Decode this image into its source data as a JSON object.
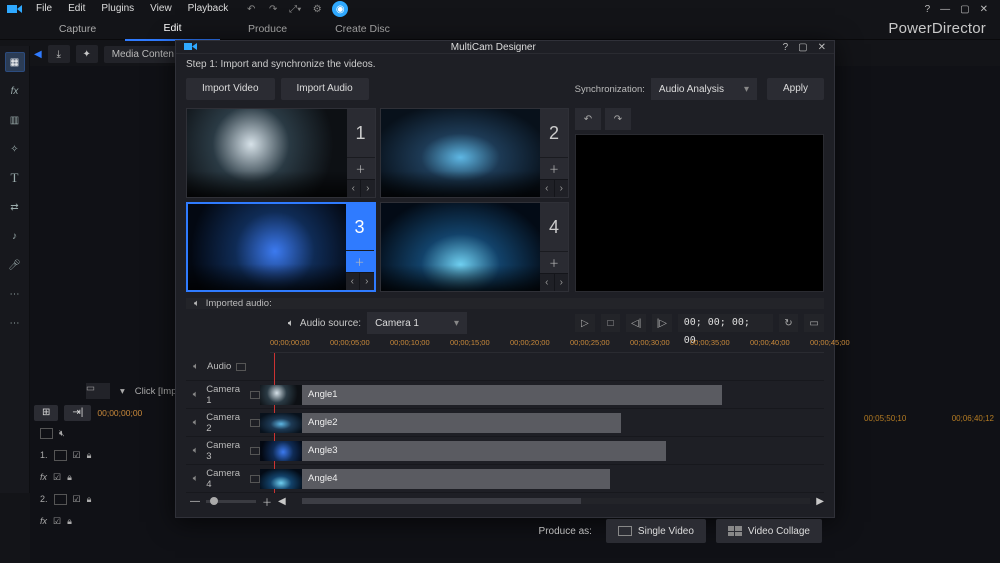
{
  "menubar": {
    "items": [
      "File",
      "Edit",
      "Plugins",
      "View",
      "Playback"
    ]
  },
  "window": {
    "help": "?",
    "min": "—",
    "close": "✕",
    "max": "▢"
  },
  "modes": {
    "items": [
      "Capture",
      "Edit",
      "Produce",
      "Create Disc"
    ],
    "active": 1
  },
  "brand": "PowerDirector",
  "shelf": {
    "media": "Media Conten"
  },
  "import_row": {
    "hint": "Click [Import]"
  },
  "bg_timeline": {
    "timecode": "00;00;00;00",
    "marks": [
      "00;05;50;10",
      "00;06;40;12"
    ],
    "rows": [
      "1.",
      "fx",
      "2.",
      "fx"
    ]
  },
  "dialog": {
    "title": "MultiCam Designer",
    "help": "?",
    "max": "▢",
    "close": "✕",
    "step": "Step 1: Import and synchronize the videos.",
    "toolbar": {
      "import_video": "Import Video",
      "import_audio": "Import Audio",
      "sync_label": "Synchronization:",
      "sync_value": "Audio Analysis",
      "apply": "Apply"
    },
    "cams": [
      {
        "num": "1"
      },
      {
        "num": "2"
      },
      {
        "num": "3",
        "selected": true
      },
      {
        "num": "4"
      }
    ],
    "imported_audio_label": "Imported audio:",
    "audio_source_label": "Audio source:",
    "audio_source_value": "Camera 1",
    "timecode": "00; 00; 00; 00",
    "ruler": [
      "00;00;00;00",
      "00;00;05;00",
      "00;00;10;00",
      "00;00;15;00",
      "00;00;20;00",
      "00;00;25;00",
      "00;00;30;00",
      "00;00;35;00",
      "00;00;40;00",
      "00;00;45;00"
    ],
    "tracks": [
      {
        "name": "Audio",
        "clip": null
      },
      {
        "name": "Camera 1",
        "clip": {
          "label": "Angle1",
          "left": 0,
          "width": 82,
          "thumb": "th1"
        }
      },
      {
        "name": "Camera 2",
        "clip": {
          "label": "Angle2",
          "left": 0,
          "width": 64,
          "thumb": "th2"
        }
      },
      {
        "name": "Camera 3",
        "clip": {
          "label": "Angle3",
          "left": 0,
          "width": 72,
          "thumb": "th3"
        }
      },
      {
        "name": "Camera 4",
        "clip": {
          "label": "Angle4",
          "left": 0,
          "width": 62,
          "thumb": "th4"
        }
      }
    ],
    "produce": {
      "label": "Produce as:",
      "single": "Single Video",
      "collage": "Video Collage"
    }
  }
}
